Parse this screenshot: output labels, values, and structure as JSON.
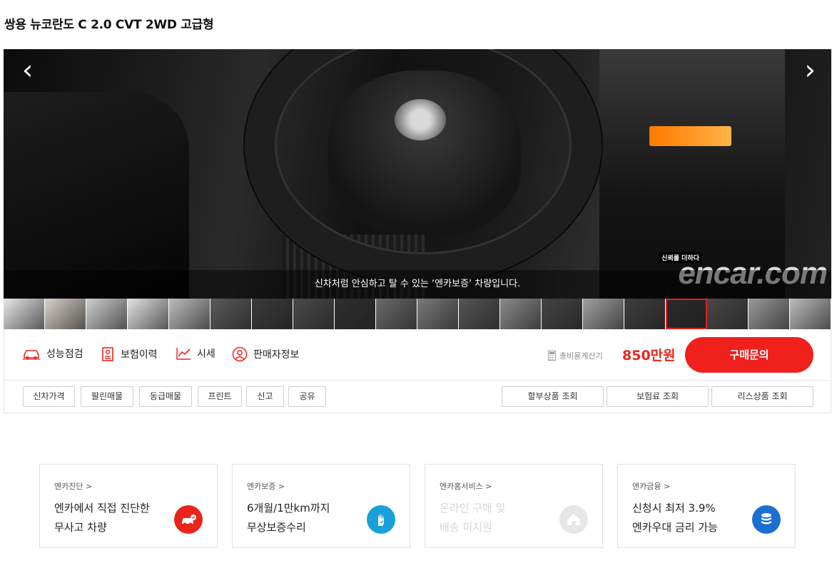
{
  "title": "쌍용 뉴코란도 C 2.0 CVT 2WD 고급형",
  "gallery": {
    "caption": "신차처럼 안심하고 탈 수 있는 ‘엔카보증’ 차량입니다.",
    "watermark_tag": "신뢰를 더하다",
    "watermark_logo": "encar.com",
    "prev_label": "‹",
    "next_label": "›",
    "thumbnail_count": 20,
    "active_thumbnail_index": 16
  },
  "features": [
    {
      "label": "성능점검",
      "icon": "car-check-icon"
    },
    {
      "label": "보험이력",
      "icon": "document-icon"
    },
    {
      "label": "시세",
      "icon": "trend-chart-icon"
    },
    {
      "label": "판매자정보",
      "icon": "person-icon"
    }
  ],
  "calculator_label": "총비용계산기",
  "price": "850만원",
  "buy_button": "구매문의",
  "actions_left": [
    "신차가격",
    "팔린매물",
    "동급매물",
    "프린트",
    "신고",
    "공유"
  ],
  "actions_right": [
    "할부상품 조회",
    "보험료 조회",
    "리스상품 조회"
  ],
  "cards": [
    {
      "category": "엔카진단 >",
      "line1": "엔카에서 직접 진단한",
      "line2": "무사고 차량",
      "icon": "car-check-icon",
      "color": "#e8261d"
    },
    {
      "category": "엔카보증 >",
      "line1": "6개월/1만km까지",
      "line2": "무상보증수리",
      "icon": "hand-icon",
      "color": "#1aa0d8"
    },
    {
      "category": "엔카홈서비스 >",
      "line1": "온라인 구매 및",
      "line2": "배송 미지원",
      "icon": "home-icon",
      "color": "#e0e0e0"
    },
    {
      "category": "엔카금융 >",
      "line1": "신청시 최저 3.9%",
      "line2": "엔카우대 금리 가능",
      "icon": "coin-stack-icon",
      "color": "#1b6fd1"
    }
  ]
}
